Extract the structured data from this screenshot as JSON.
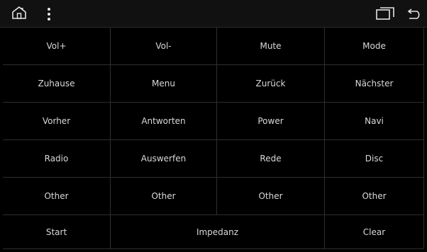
{
  "topbar": {
    "icons": [
      "home-icon",
      "more-vert-icon",
      "window-icon",
      "back-icon"
    ]
  },
  "buttons": [
    [
      "Vol+",
      "Vol-",
      "Mute",
      "Mode"
    ],
    [
      "Zuhause",
      "Menu",
      "Zurück",
      "Nächster"
    ],
    [
      "Vorher",
      "Antworten",
      "Power",
      "Navi"
    ],
    [
      "Radio",
      "Auswerfen",
      "Rede",
      "Disc"
    ],
    [
      "Other",
      "Other",
      "Other",
      "Other"
    ]
  ],
  "bottom": {
    "start": "Start",
    "impedanz": "Impedanz",
    "clear": "Clear"
  }
}
